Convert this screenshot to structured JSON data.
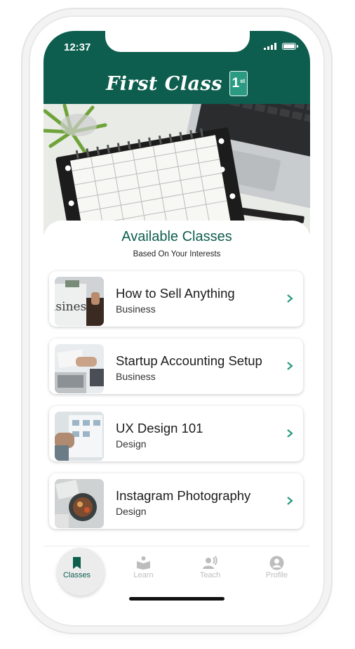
{
  "status_bar": {
    "time": "12:37"
  },
  "header": {
    "brand": "First Class",
    "badge": "1",
    "badge_sup": "st"
  },
  "section": {
    "title": "Available Classes",
    "subtitle": "Based On Your Interests"
  },
  "classes": [
    {
      "title": "How to Sell Anything",
      "category": "Business",
      "thumb_text": "isiness"
    },
    {
      "title": "Startup Accounting Setup",
      "category": "Business"
    },
    {
      "title": "UX Design 101",
      "category": "Design"
    },
    {
      "title": "Instagram Photography",
      "category": "Design"
    }
  ],
  "tabs": [
    {
      "label": "Classes",
      "icon": "bookmark-icon",
      "active": true
    },
    {
      "label": "Learn",
      "icon": "reader-icon",
      "active": false
    },
    {
      "label": "Teach",
      "icon": "speaker-icon",
      "active": false
    },
    {
      "label": "Profile",
      "icon": "user-circle-icon",
      "active": false
    }
  ],
  "colors": {
    "brand": "#0d5e4f",
    "accent": "#2b9a82",
    "tab_inactive": "#bdbdbd"
  }
}
